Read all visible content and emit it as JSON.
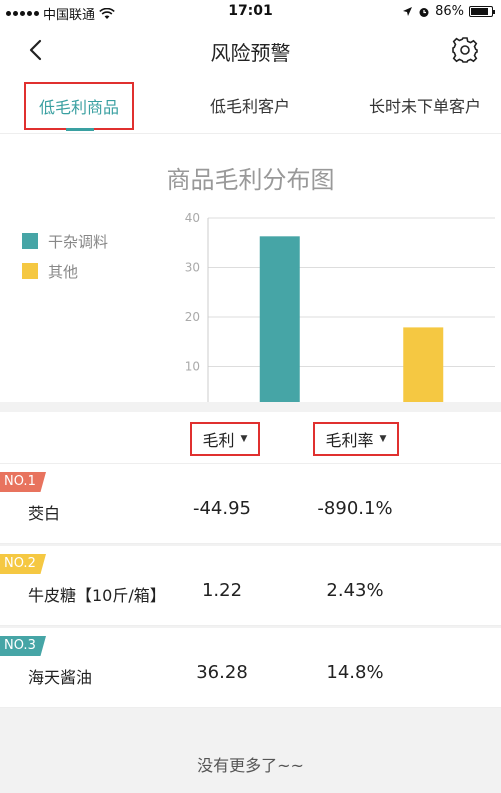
{
  "status": {
    "carrier": "中国联通",
    "time": "17:01",
    "battery": "86%",
    "battery_level": 0.86
  },
  "nav": {
    "title": "风险预警"
  },
  "tabs": [
    {
      "label": "低毛利商品"
    },
    {
      "label": "低毛利客户"
    },
    {
      "label": "长时未下单客户"
    }
  ],
  "chart_data": {
    "type": "bar",
    "title": "商品毛利分布图",
    "categories": [
      "干杂调料",
      "其他"
    ],
    "series": [
      {
        "name": "干杂调料",
        "values": [
          36.3,
          null
        ],
        "color": "#46a5a6"
      },
      {
        "name": "其他",
        "values": [
          null,
          17.9
        ],
        "color": "#f5c842"
      }
    ],
    "yticks": [
      10,
      20,
      30,
      40
    ],
    "ylim": [
      0,
      40
    ],
    "grid": true,
    "legend": "left"
  },
  "table": {
    "headers": [
      {
        "label": "毛利"
      },
      {
        "label": "毛利率"
      }
    ],
    "rows": [
      {
        "rank": "NO.1",
        "rank_color": "#e8735e",
        "name": "茭白",
        "margin": "-44.95",
        "rate": "-890.1%"
      },
      {
        "rank": "NO.2",
        "rank_color": "#f5c842",
        "name": "牛皮糖【10斤/箱】",
        "margin": "1.22",
        "rate": "2.43%"
      },
      {
        "rank": "NO.3",
        "rank_color": "#46a5a6",
        "name": "海天酱油",
        "margin": "36.28",
        "rate": "14.8%"
      }
    ]
  },
  "footer": {
    "message": "没有更多了~~"
  }
}
